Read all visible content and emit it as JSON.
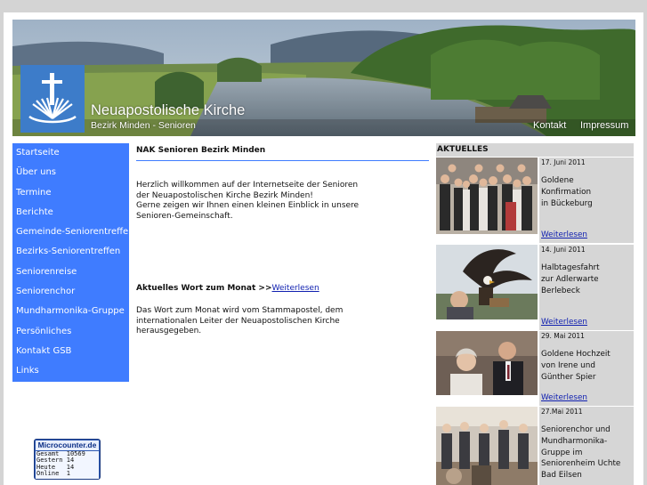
{
  "header": {
    "title": "Neuapostolische Kirche",
    "subtitle": "Bezirk Minden - Senioren",
    "links": [
      "Kontakt",
      "Impressum"
    ]
  },
  "nav": {
    "items": [
      "Startseite",
      "Über uns",
      "Termine",
      "Berichte",
      "Gemeinde-Seniorentreffen",
      "Bezirks-Seniorentreffen",
      "Seniorenreise",
      "Seniorenchor",
      "Mundharmonika-Gruppe",
      "Persönliches",
      "Kontakt GSB",
      "Links"
    ]
  },
  "main": {
    "title": "NAK Senioren Bezirk Minden",
    "intro_lines": [
      "Herzlich willkommen auf der Internetseite der Senioren",
      "der Neuapostolischen Kirche Bezirk Minden!",
      "Gerne zeigen wir Ihnen einen kleinen Einblick in unsere",
      "Senioren-Gemeinschaft."
    ],
    "wort_label": "Aktuelles Wort zum Monat >>",
    "wort_link": "Weiterlesen",
    "wort_lines": [
      "Das Wort zum Monat wird vom Stammapostel, dem",
      "internationalen Leiter der Neuapostolischen Kirche",
      "herausgegeben."
    ]
  },
  "news": {
    "heading": "AKTUELLES",
    "items": [
      {
        "date": "17. Juni 2011",
        "lines": [
          "Goldene",
          "Konfirmation",
          "in Bückeburg"
        ],
        "more": "Weiterlesen"
      },
      {
        "date": "14. Juni 2011",
        "lines": [
          "Halbtagesfahrt",
          "zur Adlerwarte",
          "Berlebeck"
        ],
        "more": "Weiterlesen"
      },
      {
        "date": "29. Mai 2011",
        "lines": [
          "Goldene Hochzeit",
          "von Irene und",
          "Günther Spier"
        ],
        "more": "Weiterlesen"
      },
      {
        "date": "27.Mai 2011",
        "lines": [
          "Seniorenchor und",
          "Mundharmonika-",
          "Gruppe im",
          "Seniorenheim Uchte",
          "Bad Eilsen"
        ],
        "more": ""
      }
    ]
  },
  "counter": {
    "title": "Microcounter.de",
    "rows": [
      {
        "label": "Gesamt",
        "value": "10569"
      },
      {
        "label": "Gestern",
        "value": "14"
      },
      {
        "label": "Heute",
        "value": "14"
      },
      {
        "label": "Online",
        "value": "1"
      }
    ]
  },
  "colors": {
    "nav_bg": "#3f7cff",
    "accent_line": "#3f7cff",
    "news_bg": "#d6d6d6",
    "link": "#1020b0",
    "page_bg": "#d4d4d4"
  }
}
